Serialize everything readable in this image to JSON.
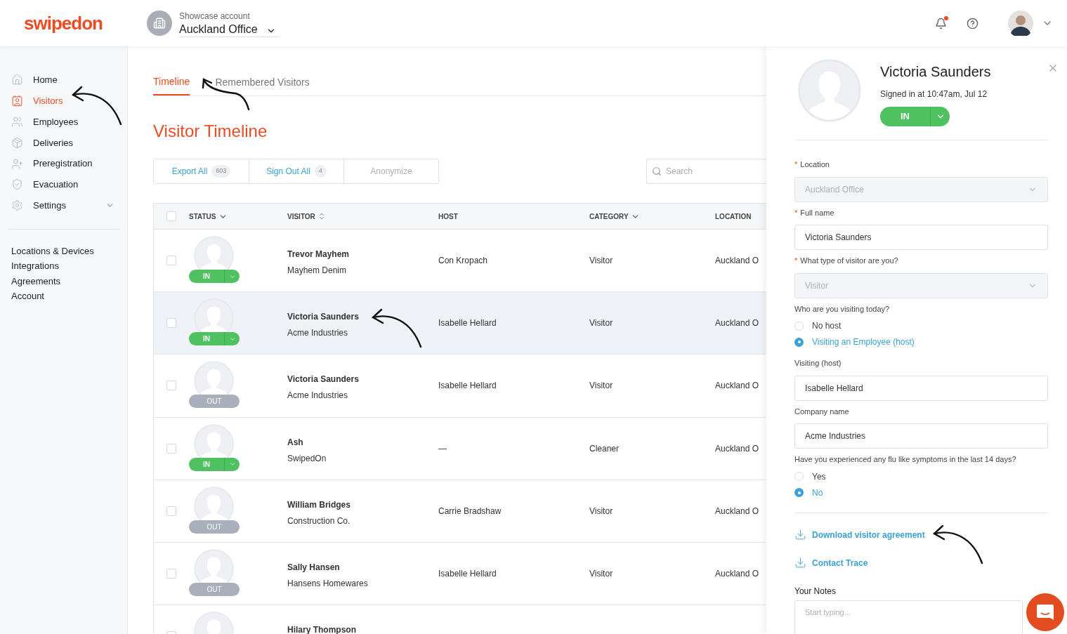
{
  "header": {
    "logo": "swipedon",
    "account_label": "Showcase account",
    "location": "Auckland Office",
    "notification_unread": true
  },
  "sidebar": {
    "items": [
      {
        "label": "Home",
        "selected": false
      },
      {
        "label": "Visitors",
        "selected": true
      },
      {
        "label": "Employees",
        "selected": false
      },
      {
        "label": "Deliveries",
        "selected": false
      },
      {
        "label": "Preregistration",
        "selected": false
      },
      {
        "label": "Evacuation",
        "selected": false
      },
      {
        "label": "Settings",
        "selected": false,
        "expandable": true
      }
    ],
    "links": [
      "Locations & Devices",
      "Integrations",
      "Agreements",
      "Account"
    ]
  },
  "tabs": [
    {
      "label": "Timeline",
      "selected": true
    },
    {
      "label": "Remembered Visitors",
      "selected": false
    }
  ],
  "page_title": "Visitor Timeline",
  "actions": [
    {
      "label": "Export All",
      "count": "603",
      "disabled": false
    },
    {
      "label": "Sign Out All",
      "count": "4",
      "disabled": false
    },
    {
      "label": "Anonymize",
      "disabled": true
    }
  ],
  "search": {
    "placeholder": "Search"
  },
  "table": {
    "select_all_checked": false,
    "columns": [
      {
        "label": "STATUS",
        "kind": "dropdown"
      },
      {
        "label": "VISITOR",
        "kind": "sortable"
      },
      {
        "label": "HOST",
        "kind": "plain"
      },
      {
        "label": "CATEGORY",
        "kind": "dropdown"
      },
      {
        "label": "LOCATION",
        "kind": "plain"
      }
    ],
    "rows": [
      {
        "checked": false,
        "selected": false,
        "status": {
          "kind": "in",
          "label": "IN"
        },
        "name": "Trevor Mayhem",
        "company": "Mayhem Denim",
        "host": "Con Kropach",
        "category": "Visitor",
        "location": "Auckland O"
      },
      {
        "checked": false,
        "selected": true,
        "status": {
          "kind": "in",
          "label": "IN"
        },
        "name": "Victoria Saunders",
        "company": "Acme Industries",
        "host": "Isabelle Hellard",
        "category": "Visitor",
        "location": "Auckland O"
      },
      {
        "checked": false,
        "selected": false,
        "status": {
          "kind": "out",
          "label": "OUT"
        },
        "name": "Victoria Saunders",
        "company": "Acme Industries",
        "host": "Isabelle Hellard",
        "category": "Visitor",
        "location": "Auckland O"
      },
      {
        "checked": false,
        "selected": false,
        "status": {
          "kind": "in",
          "label": "IN"
        },
        "name": "Ash",
        "company": "SwipedOn",
        "host": "—",
        "category": "Cleaner",
        "location": "Auckland O"
      },
      {
        "checked": false,
        "selected": false,
        "status": {
          "kind": "out",
          "label": "OUT"
        },
        "name": "William Bridges",
        "company": "Construction Co.",
        "host": "Carrie Bradshaw",
        "category": "Visitor",
        "location": "Auckland O"
      },
      {
        "checked": false,
        "selected": false,
        "status": {
          "kind": "out",
          "label": "OUT"
        },
        "name": "Sally Hansen",
        "company": "Hansens Homewares",
        "host": "Isabelle Hellard",
        "category": "Visitor",
        "location": "Auckland O"
      },
      {
        "checked": false,
        "selected": false,
        "name": "Hilary Thompson"
      }
    ]
  },
  "panel": {
    "name": "Victoria Saunders",
    "signed_in": "Signed in at 10:47am, Jul 12",
    "status": {
      "kind": "in",
      "label": "IN"
    },
    "fields": [
      {
        "kind": "select",
        "label": "Location",
        "required_mark": "*",
        "value": "Auckland Office",
        "disabled": true
      },
      {
        "kind": "input",
        "label": "Full name",
        "required_mark": "*",
        "value": "Victoria Saunders"
      },
      {
        "kind": "select",
        "label": "What type of visitor are you?",
        "required_mark": "*",
        "value": "Visitor",
        "disabled": true
      },
      {
        "kind": "radio",
        "label": "Who are you visiting today?",
        "options": [
          {
            "label": "No host",
            "selected": false
          },
          {
            "label": "Visiting an Employee (host)",
            "selected": true
          }
        ]
      },
      {
        "kind": "input",
        "label": "Visiting (host)",
        "value": "Isabelle Hellard"
      },
      {
        "kind": "input",
        "label": "Company name",
        "value": "Acme Industries"
      },
      {
        "kind": "radio",
        "label": "Have you experienced any flu like symptoms in the last 14 days?",
        "options": [
          {
            "label": "Yes",
            "selected": false
          },
          {
            "label": "No",
            "selected": true
          }
        ]
      }
    ],
    "links": [
      "Download visitor agreement",
      "Contact Trace"
    ],
    "notes": {
      "label": "Your Notes",
      "placeholder": "Start typing..."
    }
  }
}
